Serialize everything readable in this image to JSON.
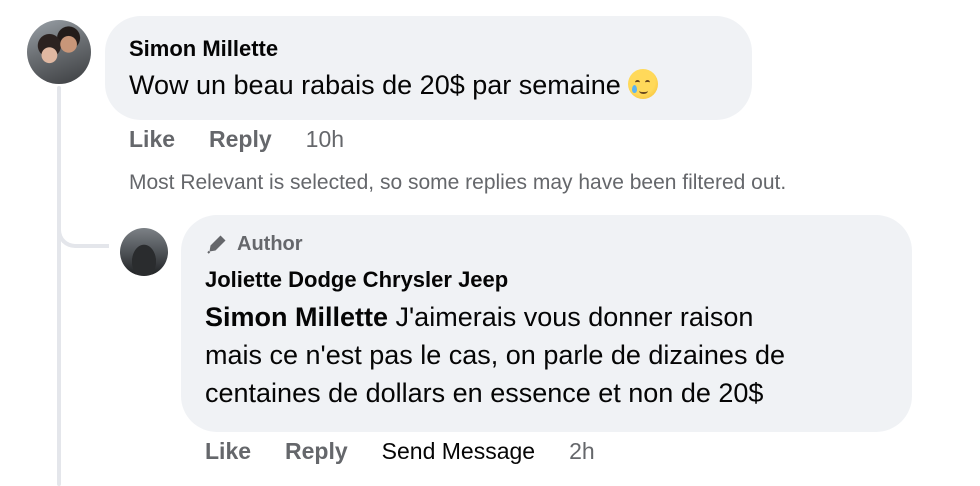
{
  "comment": {
    "author": "Simon Millette",
    "text": "Wow un beau rabais de 20$ par semaine",
    "emoji": "crying-face-with-tear-emoji",
    "actions": {
      "like": "Like",
      "reply": "Reply",
      "time": "10h"
    }
  },
  "filter_notice": "Most Relevant is selected, so some replies may have been filtered out.",
  "reply": {
    "badge": "Author",
    "author": "Joliette Dodge Chrysler Jeep",
    "mention": "Simon Millette",
    "text_line1": "J'aimerais vous donner raison",
    "text_line2": "mais ce n'est pas le cas, on parle de dizaines de",
    "text_line3": "centaines de dollars en essence et non de 20$",
    "actions": {
      "like": "Like",
      "reply": "Reply",
      "send_message": "Send Message",
      "time": "2h"
    }
  },
  "colors": {
    "bubble": "#f0f2f5",
    "secondary_text": "#65676b",
    "primary_text": "#050505",
    "thread_line": "#e4e6eb"
  }
}
